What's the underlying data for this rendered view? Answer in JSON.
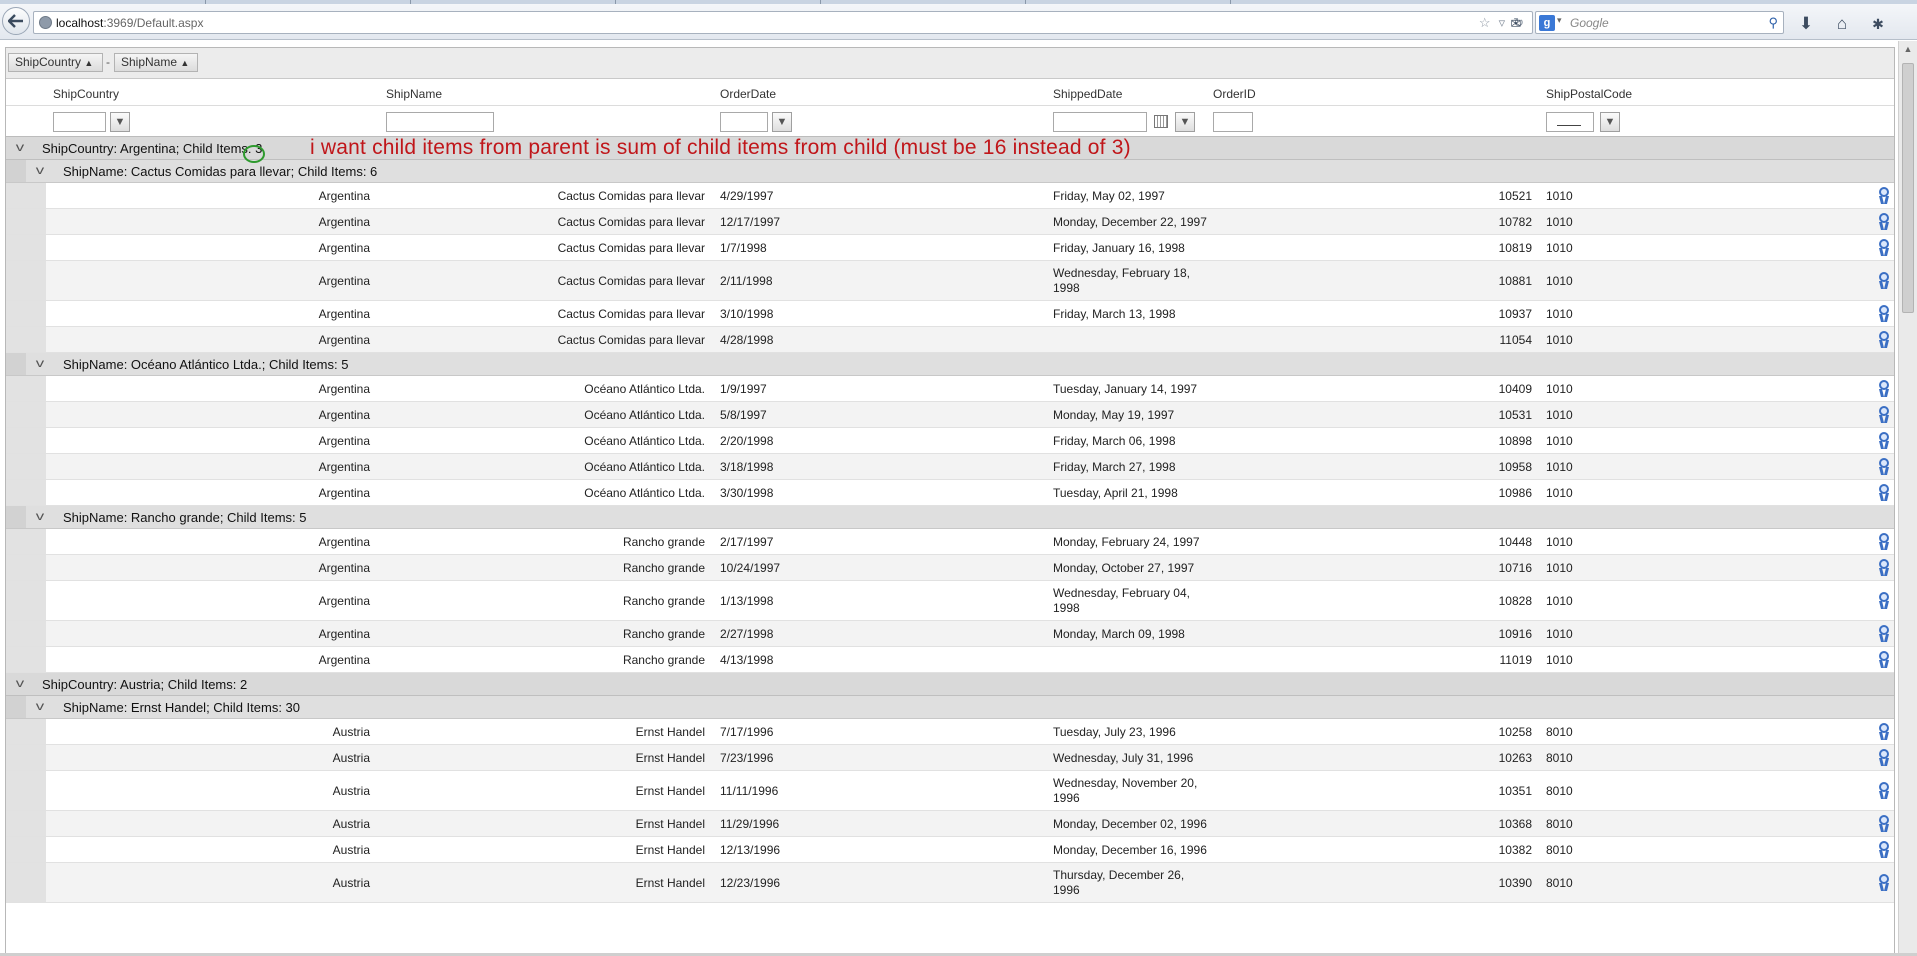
{
  "browser": {
    "url_host": "localhost",
    "url_rest": ":3969/Default.aspx",
    "search_placeholder": "Google",
    "search_engine_glyph": "g"
  },
  "annotation": "i want child items from parent is sum of child items from child (must be 16 instead of 3)",
  "group_panel": {
    "chips": [
      "ShipCountry",
      "ShipName"
    ],
    "separator": "-"
  },
  "columns": [
    "ShipCountry",
    "ShipName",
    "OrderDate",
    "ShippedDate",
    "OrderID",
    "ShipPostalCode"
  ],
  "groups": [
    {
      "header": "ShipCountry: Argentina; Child Items: 3",
      "subgroups": [
        {
          "header": "ShipName: Cactus Comidas para llevar; Child Items: 6",
          "rows": [
            [
              "Argentina",
              "Cactus Comidas para llevar",
              "4/29/1997",
              "Friday, May 02, 1997",
              "10521",
              "1010"
            ],
            [
              "Argentina",
              "Cactus Comidas para llevar",
              "12/17/1997",
              "Monday, December 22, 1997",
              "10782",
              "1010"
            ],
            [
              "Argentina",
              "Cactus Comidas para llevar",
              "1/7/1998",
              "Friday, January 16, 1998",
              "10819",
              "1010"
            ],
            [
              "Argentina",
              "Cactus Comidas para llevar",
              "2/11/1998",
              "Wednesday, February 18, 1998",
              "10881",
              "1010"
            ],
            [
              "Argentina",
              "Cactus Comidas para llevar",
              "3/10/1998",
              "Friday, March 13, 1998",
              "10937",
              "1010"
            ],
            [
              "Argentina",
              "Cactus Comidas para llevar",
              "4/28/1998",
              "",
              "11054",
              "1010"
            ]
          ]
        },
        {
          "header": "ShipName: Océano Atlántico Ltda.; Child Items: 5",
          "rows": [
            [
              "Argentina",
              "Océano Atlántico Ltda.",
              "1/9/1997",
              "Tuesday, January 14, 1997",
              "10409",
              "1010"
            ],
            [
              "Argentina",
              "Océano Atlántico Ltda.",
              "5/8/1997",
              "Monday, May 19, 1997",
              "10531",
              "1010"
            ],
            [
              "Argentina",
              "Océano Atlántico Ltda.",
              "2/20/1998",
              "Friday, March 06, 1998",
              "10898",
              "1010"
            ],
            [
              "Argentina",
              "Océano Atlántico Ltda.",
              "3/18/1998",
              "Friday, March 27, 1998",
              "10958",
              "1010"
            ],
            [
              "Argentina",
              "Océano Atlántico Ltda.",
              "3/30/1998",
              "Tuesday, April 21, 1998",
              "10986",
              "1010"
            ]
          ]
        },
        {
          "header": "ShipName: Rancho grande; Child Items: 5",
          "rows": [
            [
              "Argentina",
              "Rancho grande",
              "2/17/1997",
              "Monday, February 24, 1997",
              "10448",
              "1010"
            ],
            [
              "Argentina",
              "Rancho grande",
              "10/24/1997",
              "Monday, October 27, 1997",
              "10716",
              "1010"
            ],
            [
              "Argentina",
              "Rancho grande",
              "1/13/1998",
              "Wednesday, February 04, 1998",
              "10828",
              "1010"
            ],
            [
              "Argentina",
              "Rancho grande",
              "2/27/1998",
              "Monday, March 09, 1998",
              "10916",
              "1010"
            ],
            [
              "Argentina",
              "Rancho grande",
              "4/13/1998",
              "",
              "11019",
              "1010"
            ]
          ]
        }
      ]
    },
    {
      "header": "ShipCountry: Austria; Child Items: 2",
      "subgroups": [
        {
          "header": "ShipName: Ernst Handel; Child Items: 30",
          "rows": [
            [
              "Austria",
              "Ernst Handel",
              "7/17/1996",
              "Tuesday, July 23, 1996",
              "10258",
              "8010"
            ],
            [
              "Austria",
              "Ernst Handel",
              "7/23/1996",
              "Wednesday, July 31, 1996",
              "10263",
              "8010"
            ],
            [
              "Austria",
              "Ernst Handel",
              "11/11/1996",
              "Wednesday, November 20, 1996",
              "10351",
              "8010"
            ],
            [
              "Austria",
              "Ernst Handel",
              "11/29/1996",
              "Monday, December 02, 1996",
              "10368",
              "8010"
            ],
            [
              "Austria",
              "Ernst Handel",
              "12/13/1996",
              "Monday, December 16, 1996",
              "10382",
              "8010"
            ],
            [
              "Austria",
              "Ernst Handel",
              "12/23/1996",
              "Thursday, December 26, 1996",
              "10390",
              "8010"
            ]
          ]
        }
      ]
    }
  ],
  "colors": {
    "annotation": "#c0161a",
    "circle_mark": "#2e9a2e",
    "ribbon": "#3b6fc4"
  }
}
